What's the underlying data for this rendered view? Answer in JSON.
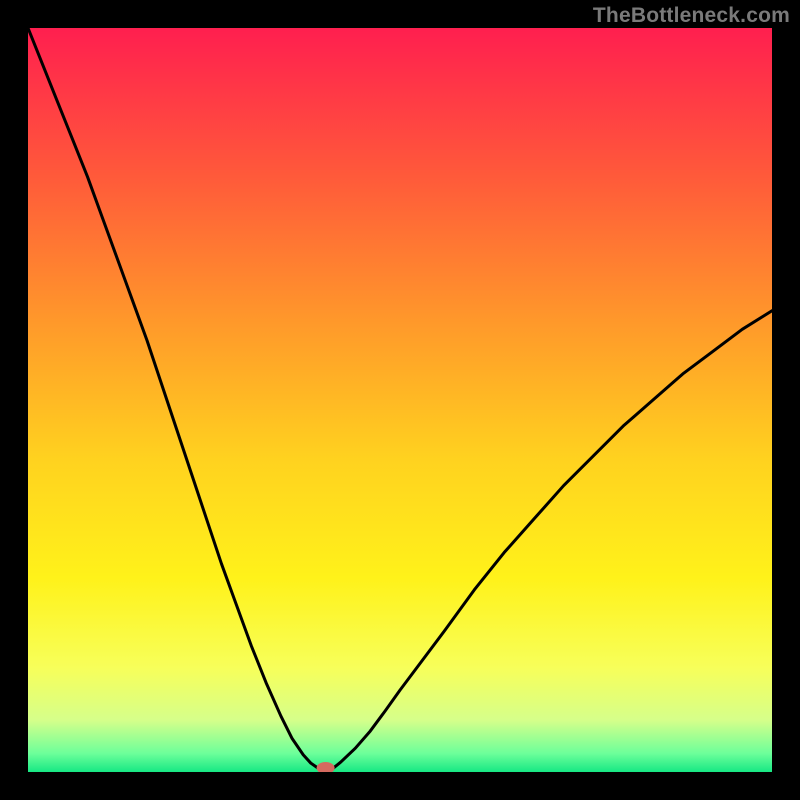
{
  "watermark": "TheBottleneck.com",
  "chart_data": {
    "type": "line",
    "title": "",
    "xlabel": "",
    "ylabel": "",
    "xlim": [
      0,
      100
    ],
    "ylim": [
      0,
      100
    ],
    "grid": false,
    "legend": false,
    "marker": {
      "x": 40,
      "y": 0,
      "color": "#d46a5f"
    },
    "gradient_stops": [
      {
        "offset": 0.0,
        "color": "#ff1f4f"
      },
      {
        "offset": 0.2,
        "color": "#ff5a3a"
      },
      {
        "offset": 0.4,
        "color": "#ff9a2a"
      },
      {
        "offset": 0.58,
        "color": "#ffd21f"
      },
      {
        "offset": 0.74,
        "color": "#fff21a"
      },
      {
        "offset": 0.86,
        "color": "#f7ff5a"
      },
      {
        "offset": 0.93,
        "color": "#d6ff8a"
      },
      {
        "offset": 0.975,
        "color": "#6dff9a"
      },
      {
        "offset": 1.0,
        "color": "#17e884"
      }
    ],
    "series": [
      {
        "name": "bottleneck-curve",
        "x": [
          0,
          2,
          4,
          6,
          8,
          10,
          12,
          14,
          16,
          18,
          20,
          22,
          24,
          26,
          28,
          30,
          32,
          34,
          35.5,
          37,
          38,
          39,
          40,
          41,
          42,
          44,
          46,
          48,
          50,
          53,
          56,
          60,
          64,
          68,
          72,
          76,
          80,
          84,
          88,
          92,
          96,
          100
        ],
        "y": [
          100,
          95,
          90,
          85,
          80,
          74.5,
          69,
          63.5,
          58,
          52,
          46,
          40,
          34,
          28,
          22.5,
          17,
          12,
          7.5,
          4.5,
          2.3,
          1.2,
          0.5,
          0,
          0.5,
          1.3,
          3.2,
          5.5,
          8.2,
          11,
          15,
          19,
          24.5,
          29.5,
          34,
          38.5,
          42.5,
          46.5,
          50,
          53.5,
          56.5,
          59.5,
          62
        ]
      }
    ]
  }
}
